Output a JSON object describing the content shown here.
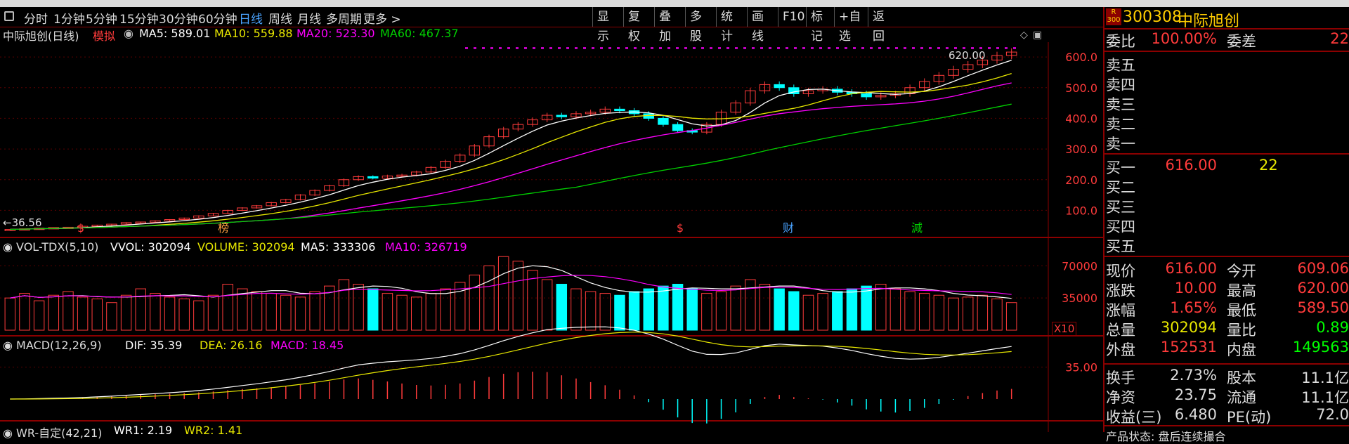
{
  "toolbar": {
    "periods": [
      "分时",
      "1分钟",
      "5分钟",
      "15分钟",
      "30分钟",
      "60分钟",
      "日线",
      "周线",
      "月线",
      "多周期",
      "更多 >"
    ],
    "active_period": "日线",
    "tools": [
      "显示",
      "复权",
      "叠加",
      "多股",
      "统计",
      "画线",
      "F10",
      "标记",
      "+自选",
      "返回"
    ]
  },
  "main_chart": {
    "title": "中际旭创(日线)",
    "mode": "模拟",
    "ma5": "MA5: 589.01",
    "ma10": "MA10: 559.88",
    "ma20": "MA20: 523.30",
    "ma60": "MA60: 467.37",
    "high_marker": "620.00",
    "low_marker": "36.56",
    "y_ticks": [
      "600.0",
      "500.0",
      "400.0",
      "300.0",
      "200.0",
      "100.0"
    ],
    "events": [
      {
        "label": "$",
        "color": "#ff3b3b"
      },
      {
        "label": "榜",
        "color": "#ffa040"
      },
      {
        "label": "$",
        "color": "#ff3b3b"
      },
      {
        "label": "财",
        "color": "#4aa3ff"
      },
      {
        "label": "減",
        "color": "#00d000"
      }
    ]
  },
  "volume_chart": {
    "title": "VOL-TDX(5,10)",
    "vvol": "VVOL: 302094",
    "volume": "VOLUME: 302094",
    "ma5": "MA5: 333306",
    "ma10": "MA10: 326719",
    "y_ticks": [
      "70000",
      "35000"
    ],
    "unit": "X10"
  },
  "macd_chart": {
    "title": "MACD(12,26,9)",
    "dif": "DIF: 35.39",
    "dea": "DEA: 26.16",
    "macd": "MACD: 18.45",
    "y_ticks": [
      "35.00"
    ]
  },
  "wr_chart": {
    "title": "WR-自定(42,21)",
    "wr1": "WR1: 2.19",
    "wr2": "WR2: 1.41"
  },
  "sidepanel": {
    "badge_top": "R",
    "badge_bottom": "300",
    "code": "300308",
    "name": "中际旭创",
    "weibi_label": "委比",
    "weibi_value": "100.00%",
    "weicha_label": "委差",
    "weicha_value": "22",
    "sell_levels": [
      "卖五",
      "卖四",
      "卖三",
      "卖二",
      "卖一"
    ],
    "buy_levels": [
      {
        "label": "买一",
        "price": "616.00",
        "vol": "22"
      },
      {
        "label": "买二",
        "price": "",
        "vol": ""
      },
      {
        "label": "买三",
        "price": "",
        "vol": ""
      },
      {
        "label": "买四",
        "price": "",
        "vol": ""
      },
      {
        "label": "买五",
        "price": "",
        "vol": ""
      }
    ],
    "stats": [
      {
        "l1": "现价",
        "v1": "616.00",
        "c1": "red",
        "l2": "今开",
        "v2": "609.06",
        "c2": "red"
      },
      {
        "l1": "涨跌",
        "v1": "10.00",
        "c1": "red",
        "l2": "最高",
        "v2": "620.00",
        "c2": "red"
      },
      {
        "l1": "涨幅",
        "v1": "1.65%",
        "c1": "red",
        "l2": "最低",
        "v2": "589.50",
        "c2": "red"
      },
      {
        "l1": "总量",
        "v1": "302094",
        "c1": "yellow",
        "l2": "量比",
        "v2": "0.89",
        "c2": "green"
      },
      {
        "l1": "外盘",
        "v1": "152531",
        "c1": "red",
        "l2": "内盘",
        "v2": "149563",
        "c2": "green"
      }
    ],
    "stats2": [
      {
        "l1": "换手",
        "v1": "2.73%",
        "c1": "white",
        "l2": "股本",
        "v2": "11.1亿",
        "c2": "white"
      },
      {
        "l1": "净资",
        "v1": "23.75",
        "c1": "white",
        "l2": "流通",
        "v2": "11.1亿",
        "c2": "white"
      },
      {
        "l1": "收益(三)",
        "v1": "6.480",
        "c1": "white",
        "l2": "PE(动)",
        "v2": "72.0",
        "c2": "white"
      }
    ],
    "footer": "产品状态: 盘后连续撮合"
  },
  "colors": {
    "up": "#ff3b3b",
    "down": "#00ffff",
    "ma5": "#ffffff",
    "ma10": "#e8e800",
    "ma20": "#ff00ff",
    "ma60": "#00d000"
  },
  "chart_data": {
    "type": "line",
    "note": "daily candlestick with moving averages",
    "close_approx": [
      38,
      40,
      42,
      44,
      45,
      48,
      52,
      55,
      60,
      62,
      66,
      70,
      75,
      82,
      90,
      100,
      108,
      115,
      125,
      135,
      150,
      165,
      180,
      200,
      210,
      205,
      212,
      215,
      225,
      240,
      260,
      280,
      310,
      340,
      365,
      380,
      395,
      410,
      405,
      415,
      420,
      430,
      425,
      415,
      400,
      380,
      360,
      355,
      380,
      420,
      450,
      490,
      510,
      500,
      480,
      490,
      495,
      485,
      480,
      470,
      475,
      480,
      500,
      520,
      540,
      560,
      575,
      590,
      605,
      616
    ],
    "volume_approx": [
      35000,
      40000,
      32000,
      38000,
      42000,
      36000,
      34000,
      30000,
      38000,
      45000,
      40000,
      36000,
      34000,
      32000,
      38000,
      50000,
      45000,
      42000,
      40000,
      38000,
      36000,
      42000,
      48000,
      55000,
      50000,
      45000,
      40000,
      38000,
      36000,
      40000,
      45000,
      52000,
      60000,
      70000,
      80000,
      75000,
      65000,
      55000,
      50000,
      45000,
      42000,
      40000,
      38000,
      42000,
      45000,
      48000,
      50000,
      45000,
      40000,
      42000,
      48000,
      55000,
      50000,
      45000,
      42000,
      38000,
      40000,
      42000,
      45000,
      48000,
      50000,
      45000,
      42000,
      40000,
      38000,
      35000,
      36000,
      38000,
      34000,
      30000
    ],
    "ylim": [
      30,
      630
    ]
  }
}
